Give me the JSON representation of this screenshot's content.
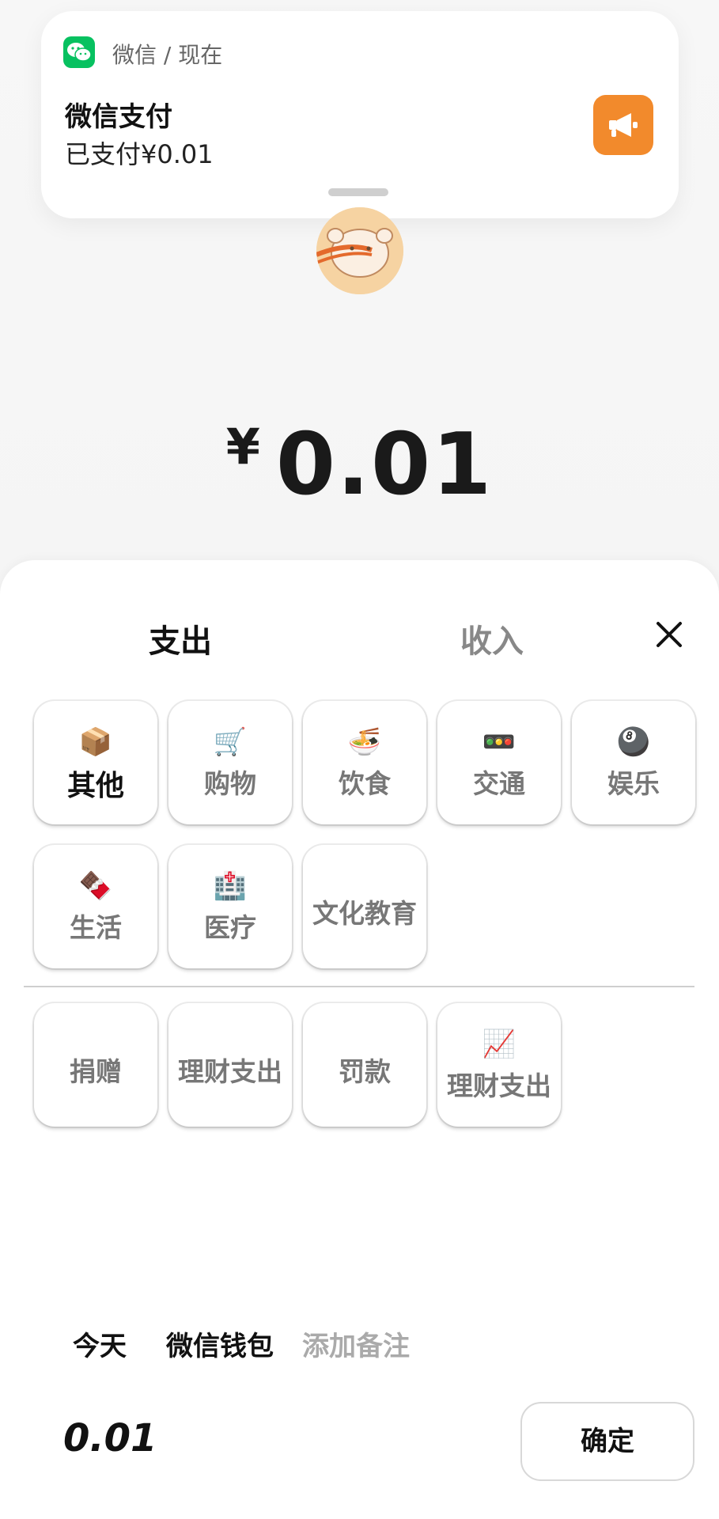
{
  "notification": {
    "source": "微信 / 现在",
    "title": "微信支付",
    "body": "已支付¥0.01",
    "app_icon": "wechat-icon",
    "action_icon": "megaphone-icon",
    "accent": "#07c160",
    "action_color": "#f28a2c"
  },
  "amount": {
    "currency": "¥",
    "value": "0.01"
  },
  "tabs": {
    "expense": "支出",
    "income": "收入"
  },
  "categories": [
    {
      "emoji": "📦",
      "label": "其他",
      "selected": true
    },
    {
      "emoji": "🛒",
      "label": "购物"
    },
    {
      "emoji": "🍜",
      "label": "饮食"
    },
    {
      "emoji": "🚥",
      "label": "交通"
    },
    {
      "emoji": "🎱",
      "label": "娱乐"
    },
    {
      "emoji": "🍫",
      "label": "生活"
    },
    {
      "emoji": "🏥",
      "label": "医疗"
    },
    {
      "emoji": "",
      "label": "文化教育"
    }
  ],
  "categories_extra": [
    {
      "emoji": "",
      "label": "捐赠"
    },
    {
      "emoji": "",
      "label": "理财支出"
    },
    {
      "emoji": "",
      "label": "罚款"
    },
    {
      "emoji": "📈",
      "label": "理财支出"
    }
  ],
  "footer": {
    "date": "今天",
    "account": "微信钱包",
    "note_placeholder": "添加备注",
    "total": "0.01",
    "confirm": "确定"
  }
}
